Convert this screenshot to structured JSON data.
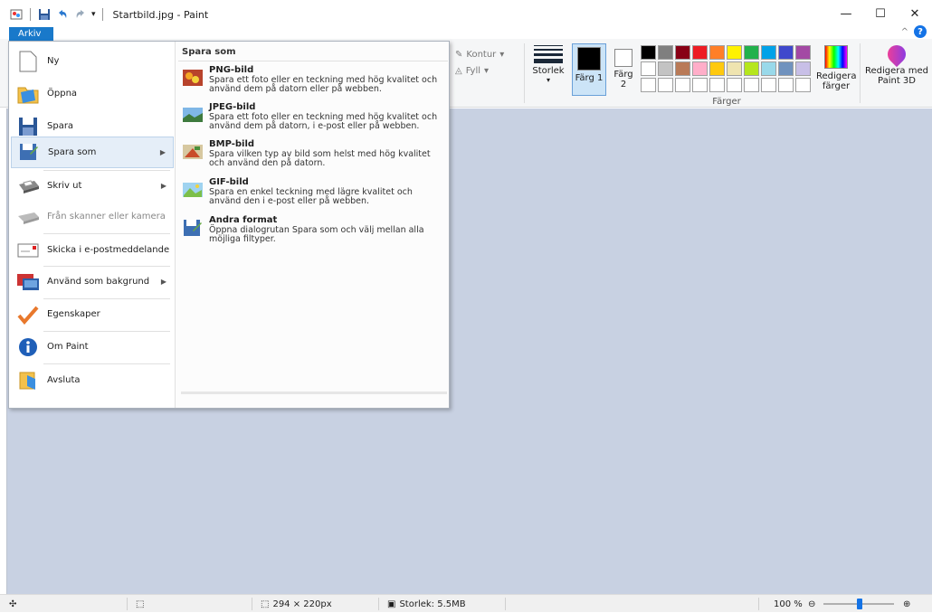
{
  "window": {
    "title": "Startbild.jpg - Paint",
    "minimize": "—",
    "maximize": "☐",
    "close": "✕"
  },
  "ribbon": {
    "file_tab": "Arkiv",
    "contour": "Kontur",
    "fill": "Fyll",
    "size": "Storlek",
    "color1": "Färg 1",
    "color2": "Färg 2",
    "colors_group": "Färger",
    "edit_colors": "Redigera färger",
    "paint3d": "Redigera med Paint 3D",
    "palette_row1": [
      "#000000",
      "#7f7f7f",
      "#880015",
      "#ed1c24",
      "#ff7f27",
      "#fff200",
      "#22b14c",
      "#00a2e8",
      "#3f48cc",
      "#a349a4"
    ],
    "palette_row2": [
      "#ffffff",
      "#c3c3c3",
      "#b97a57",
      "#ffaec9",
      "#ffc90e",
      "#efe4b0",
      "#b5e61d",
      "#99d9ea",
      "#7092be",
      "#c8bfe7"
    ],
    "palette_row3": [
      "#ffffff",
      "#ffffff",
      "#ffffff",
      "#ffffff",
      "#ffffff",
      "#ffffff",
      "#ffffff",
      "#ffffff",
      "#ffffff",
      "#ffffff"
    ]
  },
  "file_menu": {
    "items": [
      {
        "label": "Ny",
        "icon": "new-document-icon"
      },
      {
        "label": "Öppna",
        "icon": "open-folder-icon"
      },
      {
        "label": "Spara",
        "icon": "save-icon"
      },
      {
        "label": "Spara som",
        "icon": "save-as-icon"
      },
      {
        "label": "Skriv ut",
        "icon": "printer-icon"
      },
      {
        "label": "Från skanner eller kamera",
        "icon": "scanner-icon"
      },
      {
        "label": "Skicka i e-postmeddelande",
        "icon": "email-icon"
      },
      {
        "label": "Använd som bakgrund",
        "icon": "desktop-background-icon"
      },
      {
        "label": "Egenskaper",
        "icon": "checkmark-icon"
      },
      {
        "label": "Om Paint",
        "icon": "info-icon"
      },
      {
        "label": "Avsluta",
        "icon": "exit-icon"
      }
    ],
    "submenu": {
      "title": "Spara som",
      "items": [
        {
          "title": "PNG-bild",
          "desc": "Spara ett foto eller en teckning med hög kvalitet och använd dem på datorn eller på webben."
        },
        {
          "title": "JPEG-bild",
          "desc": "Spara ett foto eller en teckning med hög kvalitet och använd dem på datorn, i e-post eller på webben."
        },
        {
          "title": "BMP-bild",
          "desc": "Spara vilken typ av bild som helst med hög kvalitet och använd den på datorn."
        },
        {
          "title": "GIF-bild",
          "desc": "Spara en enkel teckning med lägre kvalitet och använd den i e-post eller på webben."
        },
        {
          "title": "Andra format",
          "desc": "Öppna dialogrutan Spara som och välj mellan alla möjliga filtyper."
        }
      ]
    }
  },
  "status": {
    "dimensions": "294 × 220px",
    "filesize": "Storlek: 5.5MB",
    "zoom": "100 %"
  }
}
